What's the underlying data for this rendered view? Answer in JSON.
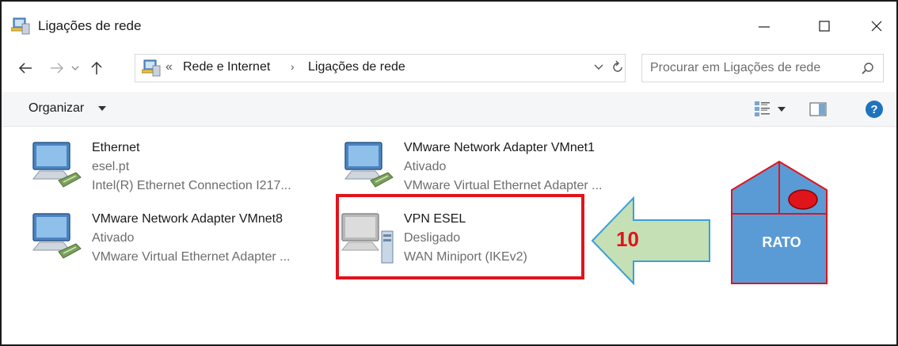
{
  "window": {
    "title": "Ligações de rede",
    "controls": {
      "minimize": "—",
      "maximize": "☐",
      "close": "✕"
    }
  },
  "address": {
    "overflow": "«",
    "breadcrumbs": [
      "Rede e Internet",
      "Ligações de rede"
    ],
    "separator": "›"
  },
  "search": {
    "placeholder": "Procurar em Ligações de rede"
  },
  "commandbar": {
    "organize_label": "Organizar"
  },
  "connections": [
    {
      "name": "Ethernet",
      "status": "esel.pt",
      "device": "Intel(R) Ethernet Connection I217...",
      "icon": "network-adapter-icon"
    },
    {
      "name": "VMware Network Adapter VMnet1",
      "status": "Ativado",
      "device": "VMware Virtual Ethernet Adapter ...",
      "icon": "network-adapter-icon"
    },
    {
      "name": "VMware Network Adapter VMnet8",
      "status": "Ativado",
      "device": "VMware Virtual Ethernet Adapter ...",
      "icon": "network-adapter-icon"
    },
    {
      "name": "VPN ESEL",
      "status": "Desligado",
      "device": "WAN Miniport (IKEv2)",
      "icon": "vpn-connection-icon"
    }
  ],
  "annotation": {
    "step_number": "10",
    "mouse_label": "RATO",
    "colors": {
      "highlight": "#e0141b",
      "arrow_fill": "#c5e0b4",
      "arrow_stroke": "#3aa0d8",
      "mouse_fill": "#5b9bd5",
      "mouse_stroke": "#e0141b"
    }
  }
}
